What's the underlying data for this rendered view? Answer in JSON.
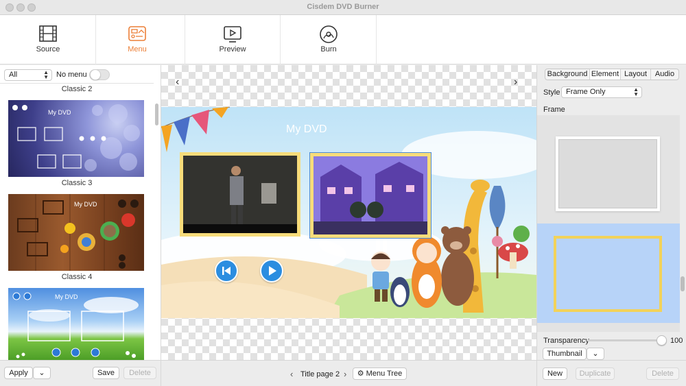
{
  "window": {
    "title": "Cisdem DVD Burner"
  },
  "toolbar": {
    "items": [
      {
        "label": "Source",
        "icon": "film-icon"
      },
      {
        "label": "Menu",
        "icon": "menu-layout-icon",
        "active": true
      },
      {
        "label": "Preview",
        "icon": "play-preview-icon"
      },
      {
        "label": "Burn",
        "icon": "disc-burn-icon"
      }
    ],
    "accent_color": "#ec7f37"
  },
  "left_panel": {
    "filter": {
      "value": "All"
    },
    "no_menu": {
      "label": "No menu",
      "on": false
    },
    "templates": [
      {
        "caption": "Classic 2"
      },
      {
        "caption": "Classic 3",
        "thumb_title": "My DVD"
      },
      {
        "caption": "Classic 4",
        "thumb_title": "My DVD"
      },
      {
        "caption": "",
        "thumb_title": "My DVD"
      }
    ],
    "footer": {
      "apply": "Apply",
      "save": "Save",
      "delete": "Delete"
    }
  },
  "canvas": {
    "menu_title": "My DVD",
    "footer": {
      "page_label": "Title page 2",
      "menu_tree": "Menu Tree"
    }
  },
  "right_panel": {
    "tabs": [
      {
        "label": "Background",
        "active": false
      },
      {
        "label": "Element",
        "active": true
      },
      {
        "label": "Layout",
        "active": false
      },
      {
        "label": "Audio",
        "active": false
      }
    ],
    "style": {
      "label": "Style",
      "value": "Frame Only"
    },
    "frame_label": "Frame",
    "transparency": {
      "label": "Transparency",
      "value": "100",
      "fraction": 1.0
    },
    "thumbnail": {
      "value": "Thumbnail"
    },
    "footer": {
      "new": "New",
      "duplicate": "Duplicate",
      "delete": "Delete"
    }
  }
}
